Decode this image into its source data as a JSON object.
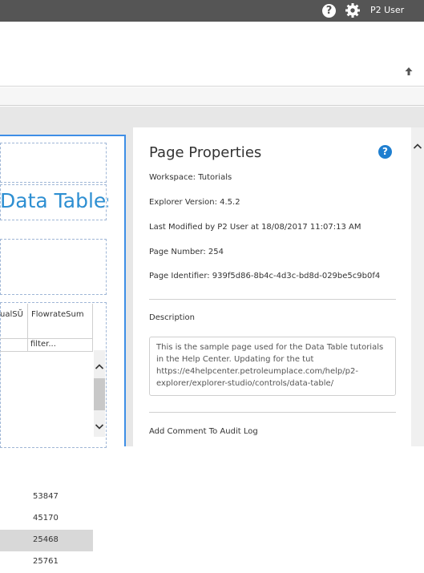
{
  "topbar": {
    "help_icon": "help-icon",
    "settings_icon": "gear-icon",
    "user_name": "P2 User"
  },
  "header": {
    "collapse_icon": "arrow-up-icon"
  },
  "editor": {
    "page_heading": "Data Tables",
    "table": {
      "columns": [
        "ualSŬ",
        "FlowrateSum"
      ],
      "filter_placeholder": "filter...",
      "rows": [
        "53847",
        "45170",
        "25468",
        "25761"
      ],
      "selected_row": 2
    }
  },
  "properties": {
    "title": "Page Properties",
    "workspace": "Workspace: Tutorials",
    "explorer_version": "Explorer Version: 4.5.2",
    "last_modified": "Last Modified by P2 User at 18/08/2017 11:07:13 AM",
    "page_number": "Page Number: 254",
    "page_identifier": "Page Identifier: 939f5d86-8b4c-4d3c-bd8d-029be5c9b0f4",
    "description_label": "Description",
    "description_text": "This is the sample page used for the Data Table tutorials in the Help Center. Updating for the tut https://e4helpcenter.petroleumplace.com/help/p2-explorer/explorer-studio/controls/data-table/",
    "audit_label": "Add Comment To Audit Log"
  },
  "colors": {
    "accent": "#2e8fd2",
    "topbar": "#555555",
    "selection_outline": "#3e8ee6"
  }
}
